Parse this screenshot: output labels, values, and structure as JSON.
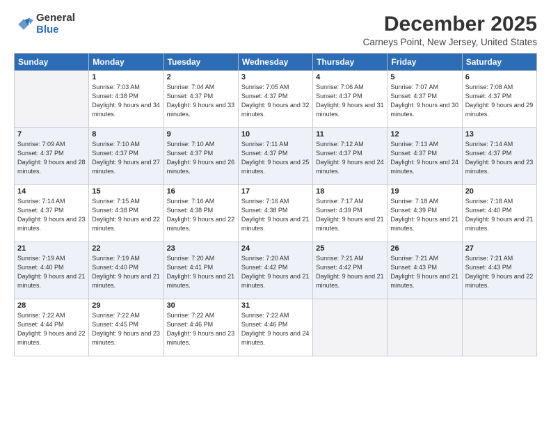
{
  "logo": {
    "general": "General",
    "blue": "Blue"
  },
  "title": "December 2025",
  "subtitle": "Carneys Point, New Jersey, United States",
  "days_of_week": [
    "Sunday",
    "Monday",
    "Tuesday",
    "Wednesday",
    "Thursday",
    "Friday",
    "Saturday"
  ],
  "weeks": [
    [
      {
        "day": "",
        "empty": true
      },
      {
        "day": "1",
        "sunrise": "7:03 AM",
        "sunset": "4:38 PM",
        "daylight": "9 hours and 34 minutes."
      },
      {
        "day": "2",
        "sunrise": "7:04 AM",
        "sunset": "4:37 PM",
        "daylight": "9 hours and 33 minutes."
      },
      {
        "day": "3",
        "sunrise": "7:05 AM",
        "sunset": "4:37 PM",
        "daylight": "9 hours and 32 minutes."
      },
      {
        "day": "4",
        "sunrise": "7:06 AM",
        "sunset": "4:37 PM",
        "daylight": "9 hours and 31 minutes."
      },
      {
        "day": "5",
        "sunrise": "7:07 AM",
        "sunset": "4:37 PM",
        "daylight": "9 hours and 30 minutes."
      },
      {
        "day": "6",
        "sunrise": "7:08 AM",
        "sunset": "4:37 PM",
        "daylight": "9 hours and 29 minutes."
      }
    ],
    [
      {
        "day": "7",
        "sunrise": "7:09 AM",
        "sunset": "4:37 PM",
        "daylight": "9 hours and 28 minutes."
      },
      {
        "day": "8",
        "sunrise": "7:10 AM",
        "sunset": "4:37 PM",
        "daylight": "9 hours and 27 minutes."
      },
      {
        "day": "9",
        "sunrise": "7:10 AM",
        "sunset": "4:37 PM",
        "daylight": "9 hours and 26 minutes."
      },
      {
        "day": "10",
        "sunrise": "7:11 AM",
        "sunset": "4:37 PM",
        "daylight": "9 hours and 25 minutes."
      },
      {
        "day": "11",
        "sunrise": "7:12 AM",
        "sunset": "4:37 PM",
        "daylight": "9 hours and 24 minutes."
      },
      {
        "day": "12",
        "sunrise": "7:13 AM",
        "sunset": "4:37 PM",
        "daylight": "9 hours and 24 minutes."
      },
      {
        "day": "13",
        "sunrise": "7:14 AM",
        "sunset": "4:37 PM",
        "daylight": "9 hours and 23 minutes."
      }
    ],
    [
      {
        "day": "14",
        "sunrise": "7:14 AM",
        "sunset": "4:37 PM",
        "daylight": "9 hours and 23 minutes."
      },
      {
        "day": "15",
        "sunrise": "7:15 AM",
        "sunset": "4:38 PM",
        "daylight": "9 hours and 22 minutes."
      },
      {
        "day": "16",
        "sunrise": "7:16 AM",
        "sunset": "4:38 PM",
        "daylight": "9 hours and 22 minutes."
      },
      {
        "day": "17",
        "sunrise": "7:16 AM",
        "sunset": "4:38 PM",
        "daylight": "9 hours and 21 minutes."
      },
      {
        "day": "18",
        "sunrise": "7:17 AM",
        "sunset": "4:39 PM",
        "daylight": "9 hours and 21 minutes."
      },
      {
        "day": "19",
        "sunrise": "7:18 AM",
        "sunset": "4:39 PM",
        "daylight": "9 hours and 21 minutes."
      },
      {
        "day": "20",
        "sunrise": "7:18 AM",
        "sunset": "4:40 PM",
        "daylight": "9 hours and 21 minutes."
      }
    ],
    [
      {
        "day": "21",
        "sunrise": "7:19 AM",
        "sunset": "4:40 PM",
        "daylight": "9 hours and 21 minutes."
      },
      {
        "day": "22",
        "sunrise": "7:19 AM",
        "sunset": "4:40 PM",
        "daylight": "9 hours and 21 minutes."
      },
      {
        "day": "23",
        "sunrise": "7:20 AM",
        "sunset": "4:41 PM",
        "daylight": "9 hours and 21 minutes."
      },
      {
        "day": "24",
        "sunrise": "7:20 AM",
        "sunset": "4:42 PM",
        "daylight": "9 hours and 21 minutes."
      },
      {
        "day": "25",
        "sunrise": "7:21 AM",
        "sunset": "4:42 PM",
        "daylight": "9 hours and 21 minutes."
      },
      {
        "day": "26",
        "sunrise": "7:21 AM",
        "sunset": "4:43 PM",
        "daylight": "9 hours and 21 minutes."
      },
      {
        "day": "27",
        "sunrise": "7:21 AM",
        "sunset": "4:43 PM",
        "daylight": "9 hours and 22 minutes."
      }
    ],
    [
      {
        "day": "28",
        "sunrise": "7:22 AM",
        "sunset": "4:44 PM",
        "daylight": "9 hours and 22 minutes."
      },
      {
        "day": "29",
        "sunrise": "7:22 AM",
        "sunset": "4:45 PM",
        "daylight": "9 hours and 23 minutes."
      },
      {
        "day": "30",
        "sunrise": "7:22 AM",
        "sunset": "4:46 PM",
        "daylight": "9 hours and 23 minutes."
      },
      {
        "day": "31",
        "sunrise": "7:22 AM",
        "sunset": "4:46 PM",
        "daylight": "9 hours and 24 minutes."
      },
      {
        "day": "",
        "empty": true
      },
      {
        "day": "",
        "empty": true
      },
      {
        "day": "",
        "empty": true
      }
    ]
  ],
  "labels": {
    "sunrise": "Sunrise:",
    "sunset": "Sunset:",
    "daylight": "Daylight:"
  }
}
